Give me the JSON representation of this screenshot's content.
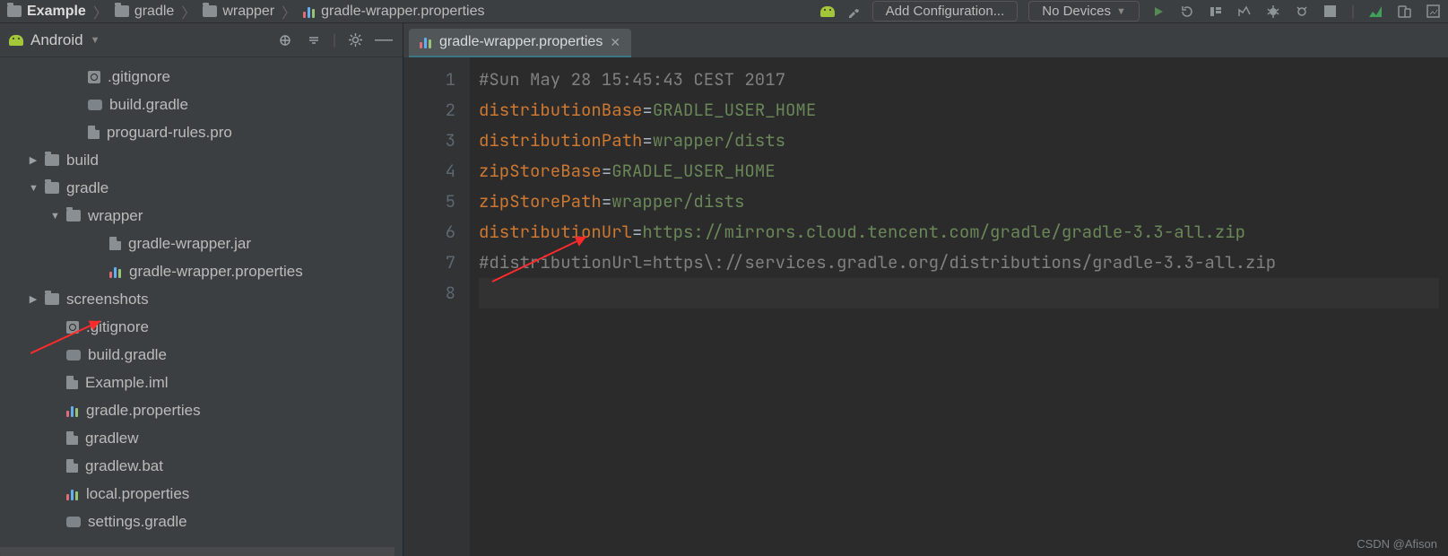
{
  "breadcrumbs": [
    "Example",
    "gradle",
    "wrapper",
    "gradle-wrapper.properties"
  ],
  "toolbar": {
    "add_config": "Add Configuration...",
    "devices": "No Devices"
  },
  "sidebar": {
    "title": "Android",
    "items": [
      {
        "indent": 3,
        "icon": "gitignore",
        "label": ".gitignore"
      },
      {
        "indent": 3,
        "icon": "gradle",
        "label": "build.gradle"
      },
      {
        "indent": 3,
        "icon": "file",
        "label": "proguard-rules.pro"
      },
      {
        "indent": 1,
        "icon": "folder",
        "arrow": "right",
        "label": "build"
      },
      {
        "indent": 1,
        "icon": "folder",
        "arrow": "down",
        "label": "gradle"
      },
      {
        "indent": 2,
        "icon": "folder",
        "arrow": "down",
        "label": "wrapper"
      },
      {
        "indent": 4,
        "icon": "file",
        "label": "gradle-wrapper.jar"
      },
      {
        "indent": 4,
        "icon": "bars",
        "label": "gradle-wrapper.properties"
      },
      {
        "indent": 1,
        "icon": "folder",
        "arrow": "right",
        "label": "screenshots"
      },
      {
        "indent": 2,
        "icon": "gitignore",
        "label": ".gitignore"
      },
      {
        "indent": 2,
        "icon": "gradle",
        "label": "build.gradle"
      },
      {
        "indent": 2,
        "icon": "file",
        "label": "Example.iml"
      },
      {
        "indent": 2,
        "icon": "bars",
        "label": "gradle.properties"
      },
      {
        "indent": 2,
        "icon": "file",
        "label": "gradlew"
      },
      {
        "indent": 2,
        "icon": "file",
        "label": "gradlew.bat"
      },
      {
        "indent": 2,
        "icon": "bars",
        "label": "local.properties"
      },
      {
        "indent": 2,
        "icon": "gradle",
        "label": "settings.gradle"
      }
    ]
  },
  "editor": {
    "tab": "gradle-wrapper.properties",
    "lines": [
      {
        "n": 1,
        "type": "comment",
        "text": "#Sun May 28 15:45:43 CEST 2017"
      },
      {
        "n": 2,
        "type": "kv",
        "key": "distributionBase",
        "value": "GRADLE_USER_HOME"
      },
      {
        "n": 3,
        "type": "kv",
        "key": "distributionPath",
        "value": "wrapper/dists"
      },
      {
        "n": 4,
        "type": "kv",
        "key": "zipStoreBase",
        "value": "GRADLE_USER_HOME"
      },
      {
        "n": 5,
        "type": "kv",
        "key": "zipStorePath",
        "value": "wrapper/dists"
      },
      {
        "n": 6,
        "type": "kv",
        "key": "distributionUrl",
        "value": "https://mirrors.cloud.tencent.com/gradle/gradle-3.3-all.zip"
      },
      {
        "n": 7,
        "type": "comment",
        "text": "#distributionUrl=https\\://services.gradle.org/distributions/gradle-3.3-all.zip"
      },
      {
        "n": 8,
        "type": "empty",
        "cursor": true
      }
    ]
  },
  "watermark": "CSDN @Afison"
}
